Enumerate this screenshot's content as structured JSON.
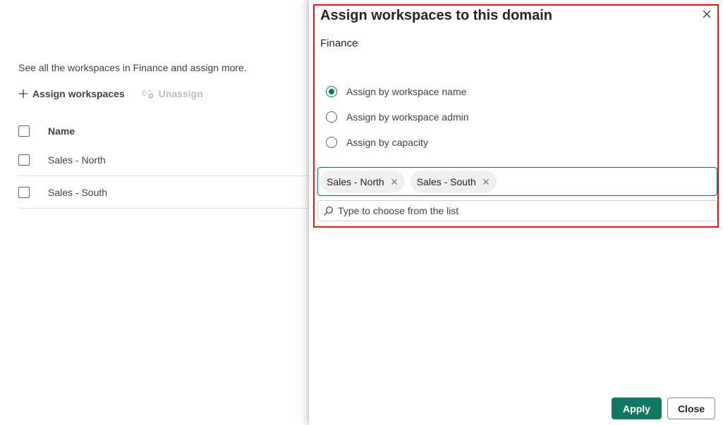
{
  "background_page": {
    "description": "See all the workspaces in Finance and assign more.",
    "toolbar": {
      "assign_label": "Assign workspaces",
      "assign_icon": "plus-icon",
      "unassign_label": "Unassign",
      "unassign_icon": "unlink-icon",
      "unassign_disabled": true
    },
    "table": {
      "header": "Name",
      "rows": [
        "Sales - North",
        "Sales - South"
      ]
    }
  },
  "panel": {
    "title": "Assign workspaces to this domain",
    "domain": "Finance",
    "radio_options": [
      {
        "label": "Assign by workspace name",
        "selected": true
      },
      {
        "label": "Assign by workspace admin",
        "selected": false
      },
      {
        "label": "Assign by capacity",
        "selected": false
      }
    ],
    "selected_workspaces": [
      "Sales - North",
      "Sales - South"
    ],
    "search": {
      "placeholder": "Type to choose from the list",
      "value": ""
    },
    "apply_label": "Apply",
    "close_label": "Close"
  },
  "colors": {
    "accent": "#117865",
    "highlight": "#d71920",
    "disabled_text": "#bdbdbd"
  }
}
